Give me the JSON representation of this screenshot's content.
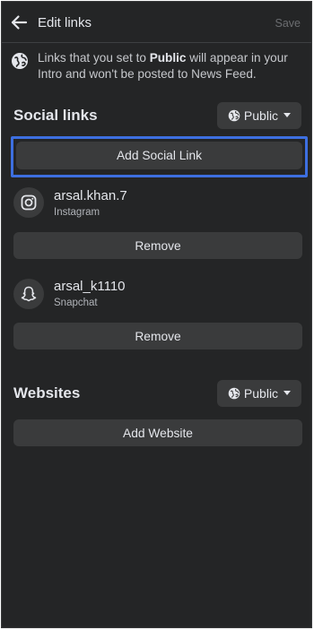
{
  "header": {
    "title": "Edit links",
    "save_label": "Save"
  },
  "notice": {
    "text_before": "Links that you set to ",
    "bold": "Public",
    "text_after": " will appear in your Intro and won't be posted to News Feed."
  },
  "social_links": {
    "title": "Social links",
    "privacy_label": "Public",
    "add_label": "Add Social Link",
    "items": [
      {
        "handle": "arsal.khan.7",
        "platform": "Instagram",
        "icon": "instagram-icon",
        "remove_label": "Remove"
      },
      {
        "handle": "arsal_k1110",
        "platform": "Snapchat",
        "icon": "snapchat-icon",
        "remove_label": "Remove"
      }
    ]
  },
  "websites": {
    "title": "Websites",
    "privacy_label": "Public",
    "add_label": "Add Website"
  },
  "colors": {
    "background": "#242526",
    "button": "#3a3b3c",
    "highlight": "#3d6fe0",
    "text": "#e4e6eb"
  }
}
